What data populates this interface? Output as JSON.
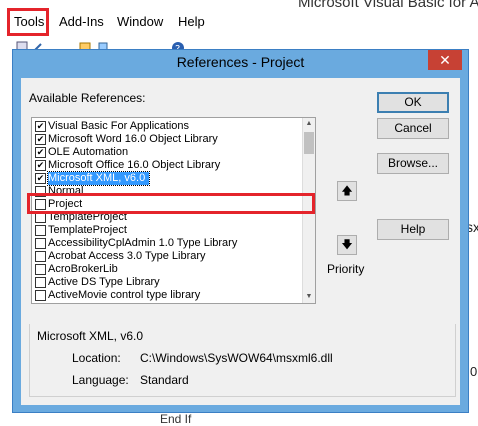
{
  "editor": {
    "title_fragment": "Microsoft Visual Basic for A",
    "menu": {
      "tools": "Tools",
      "addins": "Add-Ins",
      "window": "Window",
      "help": "Help"
    },
    "right_fragment_1": "sx",
    "right_fragment_2": "0",
    "bottom_fragment": "End If"
  },
  "dialog": {
    "title": "References - Project",
    "close_glyph": "✕",
    "available_label": "Available References:",
    "references": [
      {
        "label": "Visual Basic For Applications",
        "checked": true
      },
      {
        "label": "Microsoft Word 16.0 Object Library",
        "checked": true
      },
      {
        "label": "OLE Automation",
        "checked": true
      },
      {
        "label": "Microsoft Office 16.0 Object Library",
        "checked": true
      },
      {
        "label": "Microsoft XML, v6.0",
        "checked": true,
        "selected": true
      },
      {
        "label": "Normal",
        "checked": false
      },
      {
        "label": "Project",
        "checked": false
      },
      {
        "label": "TemplateProject",
        "checked": false
      },
      {
        "label": "TemplateProject",
        "checked": false
      },
      {
        "label": "AccessibilityCplAdmin 1.0 Type Library",
        "checked": false
      },
      {
        "label": "Acrobat Access 3.0 Type Library",
        "checked": false
      },
      {
        "label": "AcroBrokerLib",
        "checked": false
      },
      {
        "label": "Active DS Type Library",
        "checked": false
      },
      {
        "label": "ActiveMovie control type library",
        "checked": false
      }
    ],
    "buttons": {
      "ok": "OK",
      "cancel": "Cancel",
      "browse": "Browse...",
      "help": "Help"
    },
    "priority_label": "Priority",
    "info": {
      "title": "Microsoft XML, v6.0",
      "location_label": "Location:",
      "location_value": "C:\\Windows\\SysWOW64\\msxml6.dll",
      "language_label": "Language:",
      "language_value": "Standard"
    }
  },
  "colors": {
    "highlight_red": "#e4242b",
    "dialog_frame": "#6aaadf",
    "selection": "#3399ff"
  }
}
